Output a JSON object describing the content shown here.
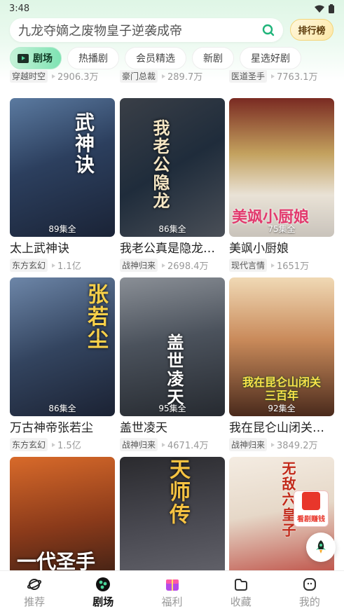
{
  "status": {
    "time": "3:48"
  },
  "search": {
    "query": "九龙夺嫡之废物皇子逆袭成帝"
  },
  "rank_button": {
    "label": "排行榜"
  },
  "tabs": [
    {
      "label": "剧场"
    },
    {
      "label": "热播剧"
    },
    {
      "label": "会员精选"
    },
    {
      "label": "新剧"
    },
    {
      "label": "星选好剧"
    }
  ],
  "cut_row": [
    {
      "tag": "穿越时空",
      "views": "2906.3万"
    },
    {
      "tag": "豪门总裁",
      "views": "289.7万"
    },
    {
      "tag": "医道圣手",
      "views": "7763.1万"
    }
  ],
  "dramas": [
    {
      "title": "太上武神诀",
      "episodes": "89集全",
      "tag": "东方玄幻",
      "views": "1.1亿",
      "poster_text": "武神诀"
    },
    {
      "title": "我老公真是隐龙…",
      "episodes": "86集全",
      "tag": "战神归来",
      "views": "2698.4万",
      "poster_text": "我老公隐龙"
    },
    {
      "title": "美飒小厨娘",
      "episodes": "75集全",
      "tag": "现代言情",
      "views": "1651万",
      "poster_text": "美飒小厨娘"
    },
    {
      "title": "万古神帝张若尘",
      "episodes": "86集全",
      "tag": "东方玄幻",
      "views": "1.5亿",
      "poster_text": "张若尘"
    },
    {
      "title": "盖世凌天",
      "episodes": "95集全",
      "tag": "战神归来",
      "views": "4671.4万",
      "poster_text": "盖世凌天"
    },
    {
      "title": "我在昆仑山闭关…",
      "episodes": "92集全",
      "tag": "战神归来",
      "views": "3849.2万",
      "poster_text": "我在昆仑山闭关三百年"
    },
    {
      "title": "",
      "episodes": "",
      "tag": "",
      "views": "",
      "poster_text": "一代圣手"
    },
    {
      "title": "",
      "episodes": "",
      "tag": "",
      "views": "",
      "poster_text": "天师传"
    },
    {
      "title": "",
      "episodes": "",
      "tag": "",
      "views": "",
      "poster_text": "无敌六皇子",
      "badge": "看剧赚钱"
    }
  ],
  "nav": [
    {
      "label": "推荐"
    },
    {
      "label": "剧场"
    },
    {
      "label": "福利"
    },
    {
      "label": "收藏"
    },
    {
      "label": "我的"
    }
  ]
}
